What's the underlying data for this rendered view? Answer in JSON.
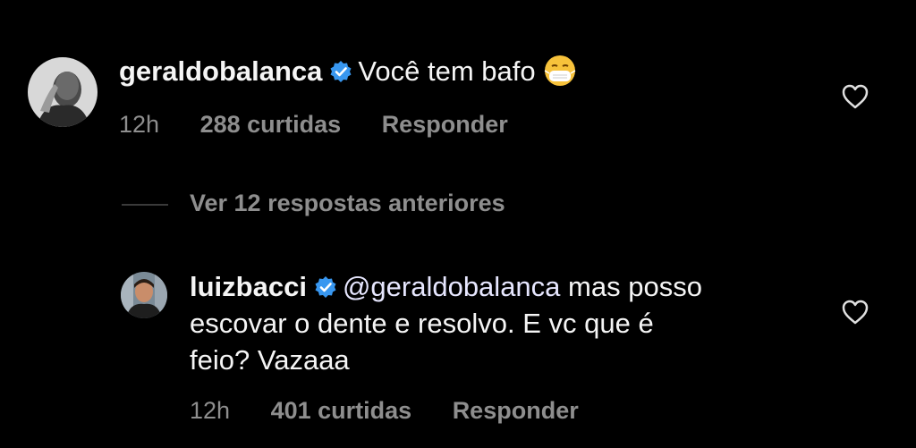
{
  "comments": [
    {
      "username": "geraldobalanca",
      "text": "Você tem bafo",
      "emoji": "mask-face-emoji",
      "time": "12h",
      "likes": "288 curtidas",
      "reply": "Responder"
    },
    {
      "username": "luizbacci",
      "mention": "@geraldobalanca",
      "text_line1": " mas posso",
      "text_line2": "escovar o dente e resolvo. E vc que é",
      "text_line3": "feio? Vazaaa",
      "time": "12h",
      "likes": "401 curtidas",
      "reply": "Responder"
    }
  ],
  "more_replies": "Ver 12 respostas anteriores",
  "colors": {
    "background": "#000000",
    "text": "#f5f5f5",
    "muted": "#8e8e8e",
    "verified": "#3897f0"
  }
}
